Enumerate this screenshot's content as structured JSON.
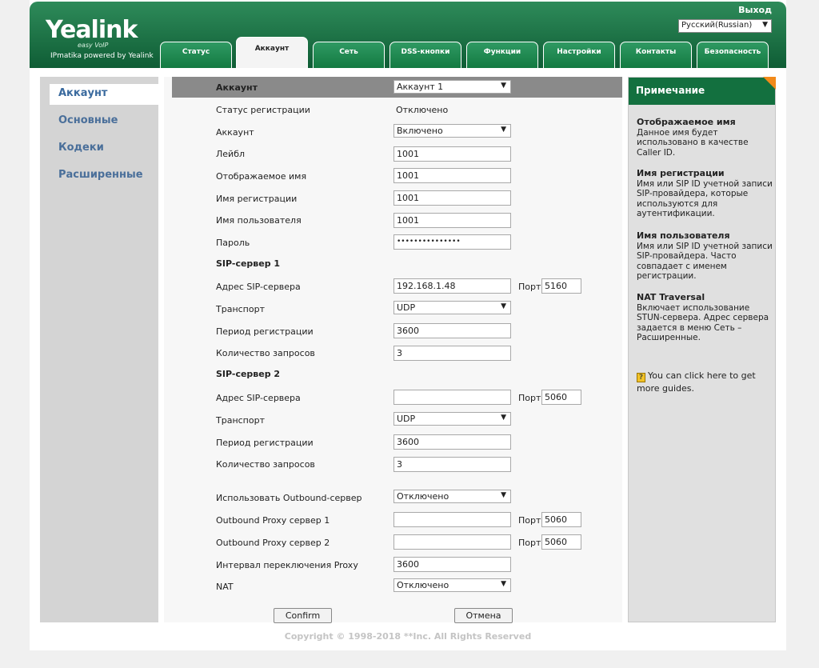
{
  "header": {
    "logo": "Yealink",
    "logo_sub": "easy VoIP",
    "tagline": "IPmatika powered by Yealink",
    "logout": "Выход",
    "language": "Русский(Russian)"
  },
  "tabs": [
    "Статус",
    "Аккаунт",
    "Сеть",
    "DSS-кнопки",
    "Функции",
    "Настройки",
    "Контакты",
    "Безопасность"
  ],
  "active_tab": "Аккаунт",
  "sidebar": {
    "items": [
      "Аккаунт",
      "Основные",
      "Кодеки",
      "Расширенные"
    ]
  },
  "form": {
    "account_header_label": "Аккаунт",
    "account_select": "Аккаунт 1",
    "reg_status_label": "Статус регистрации",
    "reg_status_value": "Отключено",
    "account_label": "Аккаунт",
    "account_value": "Включено",
    "label_label": "Лейбл",
    "label_value": "1001",
    "display_name_label": "Отображаемое имя",
    "display_name_value": "1001",
    "reg_name_label": "Имя регистрации",
    "reg_name_value": "1001",
    "username_label": "Имя пользователя",
    "username_value": "1001",
    "password_label": "Пароль",
    "password_value": "•••••••••••••••",
    "sip1_title": "SIP-сервер 1",
    "sip1_addr_label": "Адрес SIP-сервера",
    "sip1_addr_value": "192.168.1.48",
    "port_label": "Порт",
    "sip1_port": "5160",
    "sip1_transport_label": "Транспорт",
    "sip1_transport": "UDP",
    "sip1_period_label": "Период регистрации",
    "sip1_period": "3600",
    "sip1_retries_label": "Количество запросов",
    "sip1_retries": "3",
    "sip2_title": "SIP-сервер 2",
    "sip2_addr_label": "Адрес SIP-сервера",
    "sip2_addr_value": "",
    "sip2_port": "5060",
    "sip2_transport_label": "Транспорт",
    "sip2_transport": "UDP",
    "sip2_period_label": "Период регистрации",
    "sip2_period": "3600",
    "sip2_retries_label": "Количество запросов",
    "sip2_retries": "3",
    "outbound_label": "Использовать Outbound-сервер",
    "outbound_value": "Отключено",
    "proxy1_label": "Outbound Proxy сервер 1",
    "proxy1_value": "",
    "proxy1_port": "5060",
    "proxy2_label": "Outbound Proxy сервер 2",
    "proxy2_value": "",
    "proxy2_port": "5060",
    "proxy_interval_label": "Интервал переключения Proxy",
    "proxy_interval_value": "3600",
    "nat_label": "NAT",
    "nat_value": "Отключено",
    "confirm": "Confirm",
    "cancel": "Отмена"
  },
  "note": {
    "title": "Примечание",
    "blocks": [
      {
        "title": "Отображаемое имя",
        "text": "Данное имя будет использовано в качестве Caller ID."
      },
      {
        "title": "Имя регистрации",
        "text": "Имя или SIP ID учетной записи SIP-провайдера, которые используются для аутентификации."
      },
      {
        "title": "Имя пользователя",
        "text": "Имя или SIP ID учетной записи SIP-провайдера. Часто совпадает с именем регистрации."
      },
      {
        "title": "NAT Traversal",
        "text": "Включает использование STUN-сервера. Адрес сервера задается в меню Сеть – Расширенные."
      }
    ],
    "guide_text": "You can click here to get more guides."
  },
  "footer": "Copyright © 1998-2018 **Inc. All Rights Reserved",
  "colors": {
    "brand_green": "#13703f",
    "nav_text": "#4a6f9a",
    "accent_orange": "#f28a1a"
  }
}
